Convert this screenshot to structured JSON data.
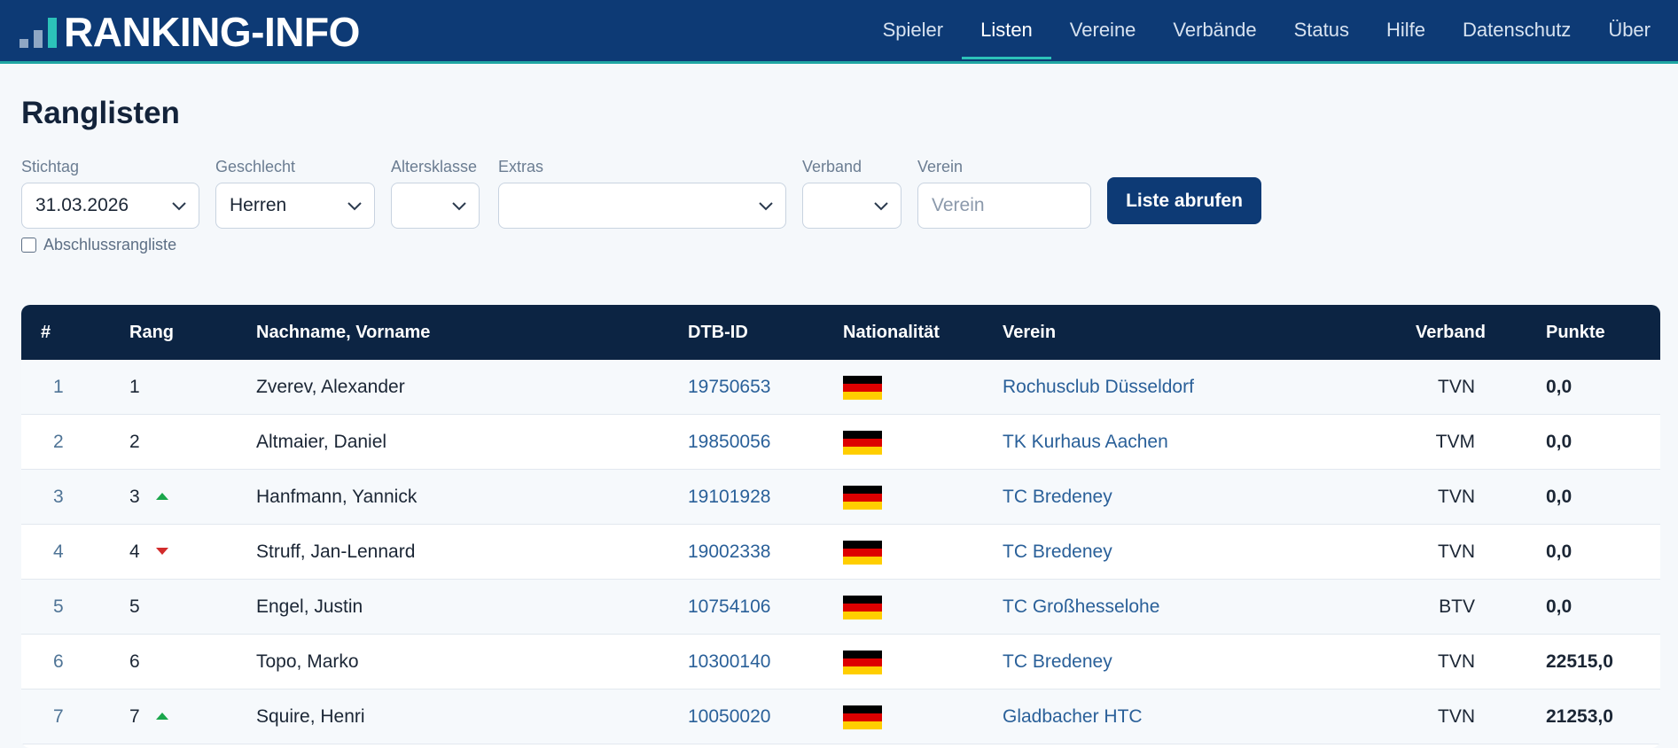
{
  "brand": {
    "name": "RANKING-INFO"
  },
  "nav": {
    "items": [
      {
        "label": "Spieler",
        "active": false
      },
      {
        "label": "Listen",
        "active": true
      },
      {
        "label": "Vereine",
        "active": false
      },
      {
        "label": "Verbände",
        "active": false
      },
      {
        "label": "Status",
        "active": false
      },
      {
        "label": "Hilfe",
        "active": false
      },
      {
        "label": "Datenschutz",
        "active": false
      },
      {
        "label": "Über",
        "active": false
      }
    ]
  },
  "page": {
    "title": "Ranglisten"
  },
  "filters": {
    "stichtag": {
      "label": "Stichtag",
      "value": "31.03.2026"
    },
    "geschlecht": {
      "label": "Geschlecht",
      "value": "Herren"
    },
    "altersklasse": {
      "label": "Altersklasse",
      "value": ""
    },
    "extras": {
      "label": "Extras",
      "value": ""
    },
    "verband": {
      "label": "Verband",
      "value": ""
    },
    "verein": {
      "label": "Verein",
      "placeholder": "Verein",
      "value": ""
    },
    "abschluss": {
      "label": "Abschlussrangliste",
      "checked": false
    },
    "submit_label": "Liste abrufen"
  },
  "table": {
    "headers": {
      "index": "#",
      "rang": "Rang",
      "name": "Nachname, Vorname",
      "dtb_id": "DTB-ID",
      "nationality": "Nationalität",
      "club": "Verein",
      "verband": "Verband",
      "punkte": "Punkte"
    },
    "flag_colors": [
      "#000000",
      "#dd0000",
      "#ffce00"
    ],
    "trend_colors": {
      "up": "#1aa64b",
      "down": "#d22b2b"
    },
    "rows": [
      {
        "index": "1",
        "rang": "1",
        "trend": "",
        "name": "Zverev, Alexander",
        "dtb_id": "19750653",
        "nationality": "germany-flag",
        "club": "Rochusclub Düsseldorf",
        "verband": "TVN",
        "punkte": "0,0"
      },
      {
        "index": "2",
        "rang": "2",
        "trend": "",
        "name": "Altmaier, Daniel",
        "dtb_id": "19850056",
        "nationality": "germany-flag",
        "club": "TK Kurhaus Aachen",
        "verband": "TVM",
        "punkte": "0,0"
      },
      {
        "index": "3",
        "rang": "3",
        "trend": "up",
        "name": "Hanfmann, Yannick",
        "dtb_id": "19101928",
        "nationality": "germany-flag",
        "club": "TC Bredeney",
        "verband": "TVN",
        "punkte": "0,0"
      },
      {
        "index": "4",
        "rang": "4",
        "trend": "down",
        "name": "Struff, Jan-Lennard",
        "dtb_id": "19002338",
        "nationality": "germany-flag",
        "club": "TC Bredeney",
        "verband": "TVN",
        "punkte": "0,0"
      },
      {
        "index": "5",
        "rang": "5",
        "trend": "",
        "name": "Engel, Justin",
        "dtb_id": "10754106",
        "nationality": "germany-flag",
        "club": "TC Großhesselohe",
        "verband": "BTV",
        "punkte": "0,0"
      },
      {
        "index": "6",
        "rang": "6",
        "trend": "",
        "name": "Topo, Marko",
        "dtb_id": "10300140",
        "nationality": "germany-flag",
        "club": "TC Bredeney",
        "verband": "TVN",
        "punkte": "22515,0"
      },
      {
        "index": "7",
        "rang": "7",
        "trend": "up",
        "name": "Squire, Henri",
        "dtb_id": "10050020",
        "nationality": "germany-flag",
        "club": "Gladbacher HTC",
        "verband": "TVN",
        "punkte": "21253,0"
      }
    ]
  }
}
